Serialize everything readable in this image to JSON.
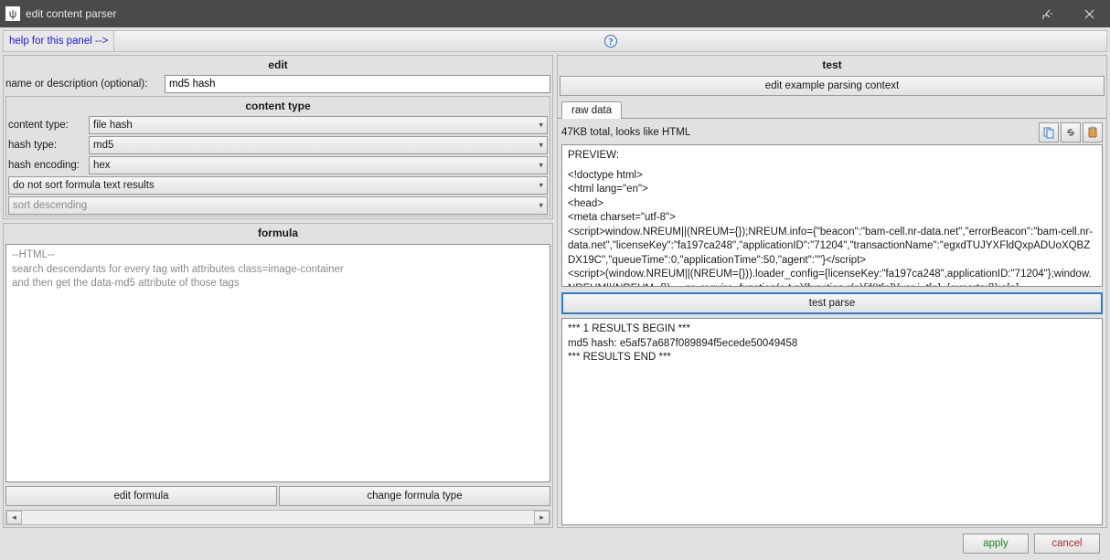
{
  "window": {
    "title": "edit content parser"
  },
  "helpbar": {
    "label": "help for this panel -->"
  },
  "edit_panel": {
    "title": "edit",
    "name_label": "name or description (optional):",
    "name_value": "md5 hash",
    "content_type_title": "content type",
    "content_type_label": "content type:",
    "content_type_value": "file hash",
    "hash_type_label": "hash type:",
    "hash_type_value": "md5",
    "hash_encoding_label": "hash encoding:",
    "hash_encoding_value": "hex",
    "sort_option": "do not sort formula text results",
    "sort_direction": "sort descending"
  },
  "formula_panel": {
    "title": "formula",
    "line1": "--HTML--",
    "line2": "search descendants for every tag with attributes class=image-container",
    "line3": "and then get the data-md5 attribute of those tags",
    "edit_btn": "edit formula",
    "change_btn": "change formula type"
  },
  "test_panel": {
    "title": "test",
    "edit_context_btn": "edit example parsing context",
    "tab_label": "raw data",
    "status_text": "47KB total, looks like HTML",
    "preview_title": "PREVIEW:",
    "preview_lines": [
      "<!doctype html>",
      "<html lang=\"en\">",
      "<head>",
      "  <meta charset=\"utf-8\">",
      "<script>window.NREUM||(NREUM={});NREUM.info={\"beacon\":\"bam-cell.nr-data.net\",\"errorBeacon\":\"bam-cell.nr-data.net\",\"licenseKey\":\"fa197ca248\",\"applicationID\":\"71204\",\"transactionName\":\"egxdTUJYXFldQxpADUoXQBZDX19C\",\"queueTime\":0,\"applicationTime\":50,\"agent\":\"\"}</script>",
      "<script>(window.NREUM||(NREUM={})).loader_config={licenseKey:\"fa197ca248\",applicationID:\"71204\"};window.NREUM||(NREUM={}),__nr_require=function(e,t,n){function r(n){if(!t[n]){var i=t[n]={exports:{}};e[n]"
    ],
    "test_parse_btn": "test parse",
    "results_line1": "*** 1 RESULTS BEGIN ***",
    "results_line2": "md5 hash: e5af57a687f089894f5ecede50049458",
    "results_line3": "*** RESULTS END ***"
  },
  "footer": {
    "apply": "apply",
    "cancel": "cancel"
  }
}
